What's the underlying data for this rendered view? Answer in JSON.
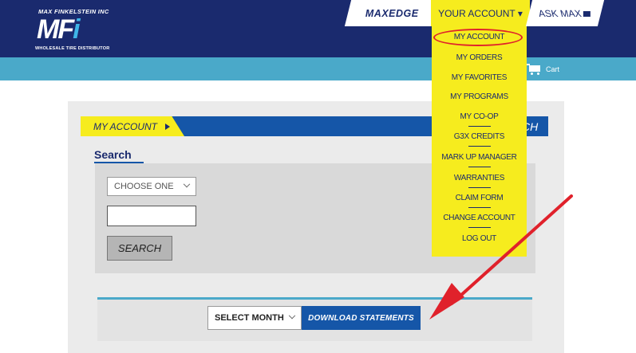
{
  "header": {
    "company_name": "MAX FINKELSTEIN INC",
    "logo_text_main": "MF",
    "logo_text_accent": "i",
    "tagline": "WHOLESALE TIRE DISTRIBUTOR",
    "nav": {
      "maxedge": "MAXEDGE",
      "your_account": "YOUR ACCOUNT",
      "ask_max": "ASK MAX"
    },
    "cart_label": "Cart"
  },
  "account_dropdown": {
    "items": [
      "MY ACCOUNT",
      "MY ORDERS",
      "MY FAVORITES",
      "MY PROGRAMS",
      "MY CO-OP",
      "G3X CREDITS",
      "MARK UP MANAGER",
      "WARRANTIES",
      "CLAIM FORM",
      "CHANGE ACCOUNT",
      "LOG OUT"
    ],
    "highlighted": "MY ACCOUNT"
  },
  "main": {
    "account_tab": "MY ACCOUNT",
    "right_partial_text": "CH",
    "search_title": "Search",
    "choose_select": "CHOOSE ONE",
    "search_input_value": "",
    "search_button": "SEARCH",
    "month_select": "SELECT MONTH",
    "download_button": "DOWNLOAD STATEMENTS"
  },
  "colors": {
    "navy": "#1a2a6e",
    "blue": "#1556a8",
    "yellow": "#f6ec1e",
    "teal": "#4aa9c9",
    "annotation_red": "#e0212b"
  }
}
